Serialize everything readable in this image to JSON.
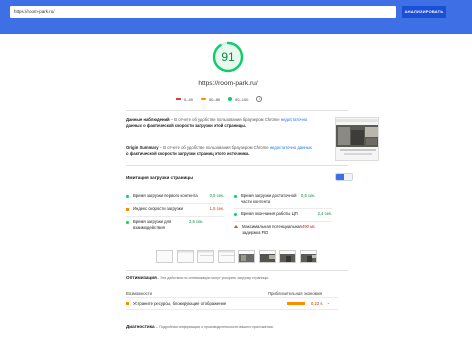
{
  "search": {
    "url_value": "https://room-park.ru/",
    "analyze_label": "АНАЛИЗИРОВАТЬ"
  },
  "score": {
    "value": "91",
    "fraction": 0.91,
    "color": "#0cce6b",
    "url": "https://room-park.ru/"
  },
  "legend": [
    {
      "label": "0–49",
      "color": "#e53935"
    },
    {
      "label": "50–89",
      "color": "#fb8c00"
    },
    {
      "label": "90–100",
      "color": "#0cce6b"
    }
  ],
  "field": {
    "title": "Данные наблюдений",
    "text_1": " – В отчете об удобстве пользования браузером Chrome ",
    "link": "недостаточно",
    "text_2": "данных о фактической скорости загрузки этой страницы."
  },
  "origin": {
    "title": "Origin Summary",
    "text_1": " – В отчете об удобстве пользования браузером Chrome ",
    "link": "недостаточно данных",
    "text_2": " о фактической скорости загрузки страниц этого источника."
  },
  "lab": {
    "title": "Имитация загрузки страницы",
    "left_metrics": [
      {
        "name": "Время загрузки первого контента",
        "value": "0,5 сек.",
        "status": "green"
      },
      {
        "name": "Индекс скорости загрузки",
        "value": "1,5 сек.",
        "status": "orange"
      },
      {
        "name": "Время загрузки для взаимодействия",
        "value": "2,5 сек.",
        "status": "green"
      }
    ],
    "right_metrics": [
      {
        "name": "Время загрузки достаточной части контента",
        "value": "0,5 сек.",
        "status": "green"
      },
      {
        "name": "Время окончания работы ЦП",
        "value": "2,4 сек.",
        "status": "green"
      },
      {
        "name": "Максимальная потенциальная задержка FID",
        "value": "490 мс",
        "status": "red"
      }
    ]
  },
  "opportunities": {
    "title": "Оптимизация",
    "description": " – Эти действия по оптимизации могут ускорить загрузку страницы.",
    "col_left": "Возможности",
    "col_right": "Приблизительная экономия",
    "rows": [
      {
        "label": "Устраните ресурсы, блокирующие отображение",
        "saving": "0,22 s",
        "bar_fraction": 0.25,
        "status": "orange"
      }
    ]
  },
  "diagnostics": {
    "title": "Диагностика",
    "description": " – Подробная информация о производительности вашего приложения."
  }
}
